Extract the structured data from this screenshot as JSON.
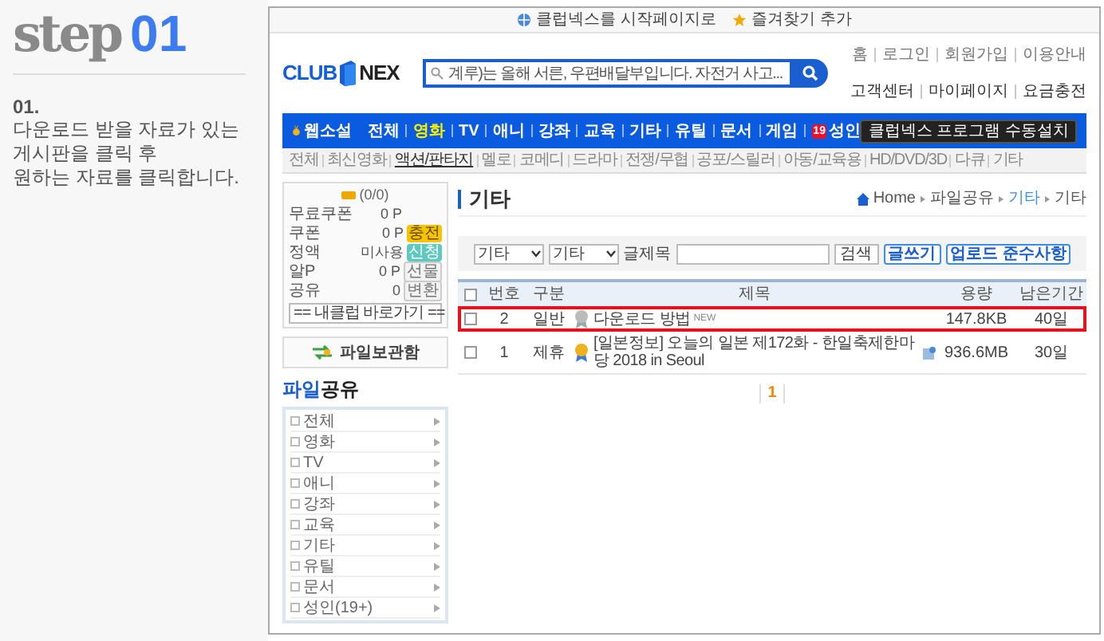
{
  "step": {
    "word": "step",
    "number": "01",
    "index": "01.",
    "lines": [
      "다운로드 받을 자료가 있는",
      "게시판을 클릭 후",
      "원하는 자료를 클릭합니다."
    ]
  },
  "top_links": [
    {
      "label": "클럽넥스를 시작페이지로",
      "kind": "home"
    },
    {
      "label": "즐겨찾기 추가",
      "kind": "star"
    }
  ],
  "util_links": [
    "홈",
    "로그인",
    "회원가입",
    "이용안내"
  ],
  "logo": {
    "left": "CLUB",
    "right": "NEX"
  },
  "search": {
    "placeholder": "계루)는 올해 서른, 우편배달부입니다. 자전거 사고..."
  },
  "account_links": [
    "고객센터",
    "마이페이지",
    "요금충전"
  ],
  "nav": {
    "badge": "웹소설",
    "items": [
      {
        "label": "전체",
        "selected": false
      },
      {
        "label": "영화",
        "selected": true
      },
      {
        "label": "TV",
        "selected": false
      },
      {
        "label": "애니",
        "selected": false
      },
      {
        "label": "강좌",
        "selected": false
      },
      {
        "label": "교육",
        "selected": false
      },
      {
        "label": "기타",
        "selected": false
      },
      {
        "label": "유틸",
        "selected": false
      },
      {
        "label": "문서",
        "selected": false
      },
      {
        "label": "게임",
        "selected": false
      },
      {
        "label": "성인",
        "selected": false,
        "mark": "19"
      }
    ],
    "install_button": "클럽넥스 프로그램 수동설치"
  },
  "subnav": [
    {
      "label": "전체",
      "selected": false
    },
    {
      "label": "최신영화",
      "selected": false
    },
    {
      "label": "액션/판타지",
      "selected": true
    },
    {
      "label": "멜로",
      "selected": false
    },
    {
      "label": "코메디",
      "selected": false
    },
    {
      "label": "드라마",
      "selected": false
    },
    {
      "label": "전쟁/무협",
      "selected": false
    },
    {
      "label": "공포/스릴러",
      "selected": false
    },
    {
      "label": "아동/교육용",
      "selected": false
    },
    {
      "label": "HD/DVD/3D",
      "selected": false
    },
    {
      "label": "다큐",
      "selected": false
    },
    {
      "label": "기타",
      "selected": false
    }
  ],
  "points": {
    "count": "(0/0)",
    "rows": [
      {
        "label": "무료쿠폰",
        "value": "0 P"
      },
      {
        "label": "쿠폰",
        "value": "0 P",
        "action": "충전",
        "kind": "charge"
      },
      {
        "label": "정액",
        "value": "미사용",
        "action": "신청",
        "kind": "apply"
      },
      {
        "label": "알P",
        "value": "0 P",
        "action": "선물",
        "kind": "plain"
      },
      {
        "label": "공유",
        "value": "0",
        "action": "변환",
        "kind": "plain"
      }
    ],
    "shortcut": "== 내클럽 바로가기 =="
  },
  "storage_button": "파일보관함",
  "share_title": {
    "highlight": "파일",
    "rest": "공유"
  },
  "categories": [
    "전체",
    "영화",
    "TV",
    "애니",
    "강좌",
    "교육",
    "기타",
    "유틸",
    "문서",
    "성인(19+)"
  ],
  "board": {
    "title": "기타",
    "breadcrumb": [
      {
        "label": "Home",
        "selected": false
      },
      {
        "label": "파일공유",
        "selected": false
      },
      {
        "label": "기타",
        "selected": true
      },
      {
        "label": "기타",
        "selected": false
      }
    ]
  },
  "filter": {
    "selects": [
      "기타",
      "기타"
    ],
    "label": "글제목",
    "search_button": "검색",
    "write_button": "글쓰기",
    "rules_button": "업로드 준수사항"
  },
  "table": {
    "all_checked": false,
    "columns": [
      "번호",
      "구분",
      "제목",
      "용량",
      "남은기간"
    ],
    "rows": [
      {
        "checked": false,
        "highlighted": true,
        "kind": "normal",
        "number": "2",
        "type": "일반",
        "title": "다운로드 방법",
        "badge": "NEW",
        "attached": false,
        "size": "147.8KB",
        "remaining": "40일"
      },
      {
        "checked": false,
        "highlighted": false,
        "kind": "partner",
        "number": "1",
        "type": "제휴",
        "title": "[일본정보] 오늘의 일본 제172화 - 한일축제한마당 2018 in Seoul",
        "attached": true,
        "size": "936.6MB",
        "remaining": "30일"
      }
    ]
  },
  "pagination": [
    {
      "label": "1",
      "selected": true
    }
  ]
}
